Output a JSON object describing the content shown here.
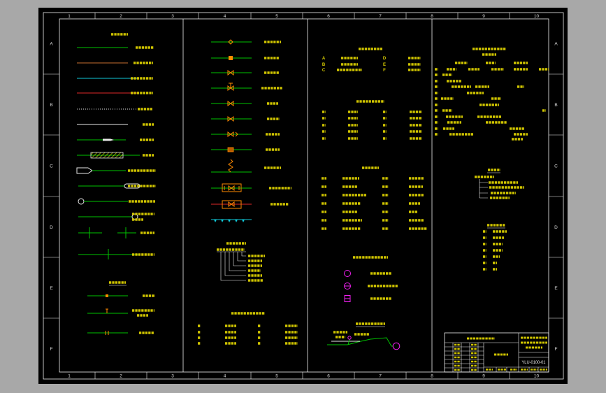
{
  "viewer": {
    "background_color": "#a8a8a8"
  },
  "sheet": {
    "columns": [
      "1",
      "2",
      "3",
      "4",
      "5",
      "6",
      "7",
      "8",
      "9",
      "10"
    ],
    "rows": [
      "A",
      "B",
      "C",
      "D",
      "E",
      "F"
    ],
    "drawing_number": "YLU-0100-01"
  },
  "material_codes": {
    "left": [
      "A",
      "B",
      "C"
    ],
    "right": [
      "D",
      "E",
      "F"
    ]
  },
  "colors": {
    "sheet": "#000000",
    "frame": "#f0f0f0",
    "text": "#d4c800",
    "pipe_green": "#00c400",
    "pipe_brown": "#c87030",
    "pipe_cyan": "#10c8d8",
    "pipe_red": "#e02828",
    "valve_orange": "#ff8a00",
    "symbol_magenta": "#f020f0"
  }
}
